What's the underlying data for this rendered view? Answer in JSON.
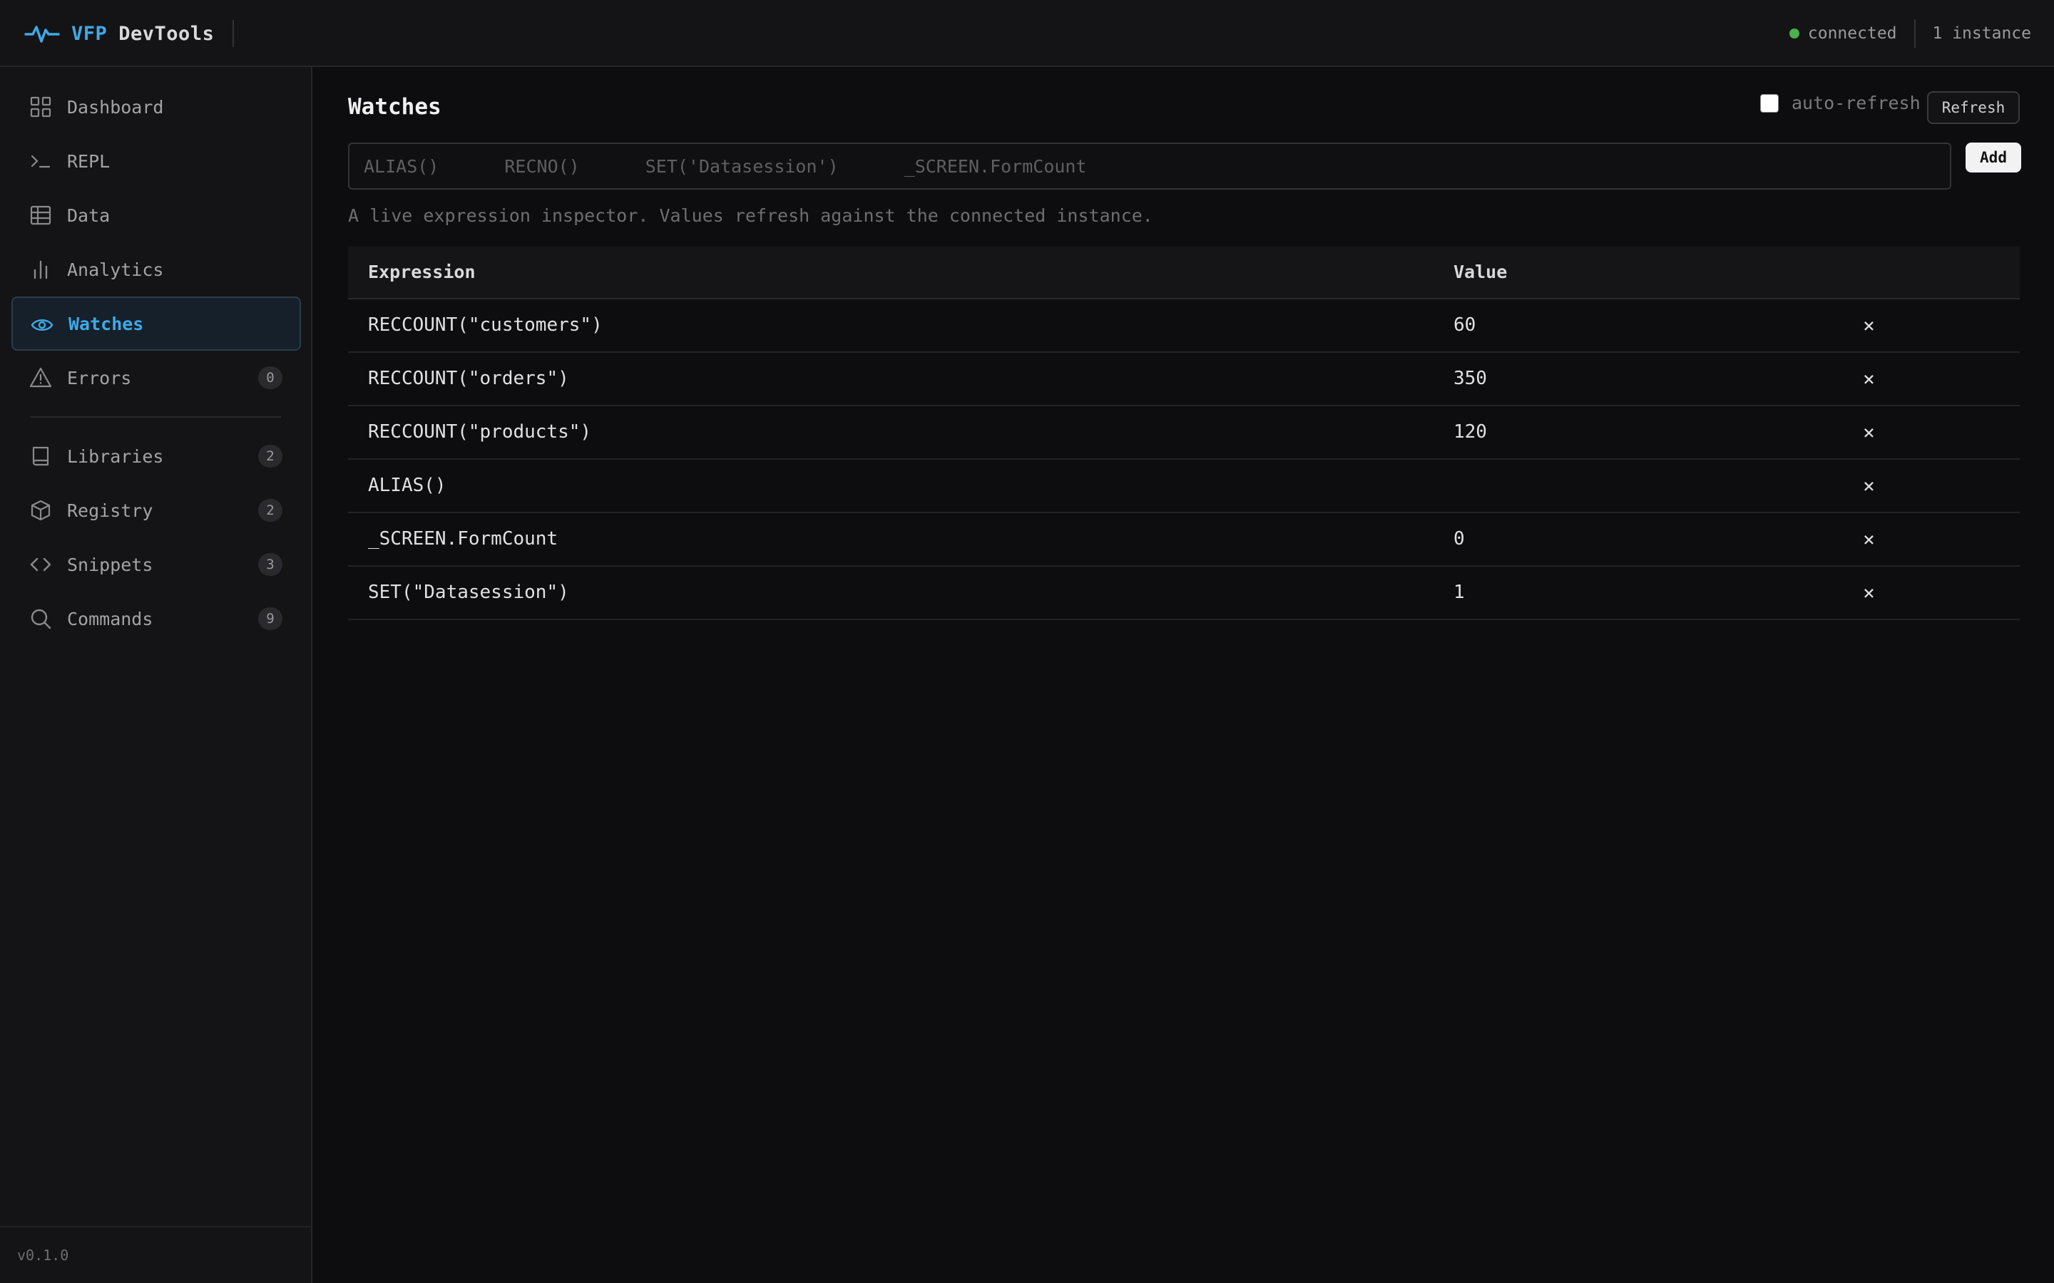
{
  "header": {
    "brand_vfp": "VFP",
    "brand_rest": "DevTools",
    "status": "connected",
    "instances": "1 instance",
    "status_color": "#4caf50",
    "accent_color": "#3fa9e8"
  },
  "sidebar": {
    "items": [
      {
        "label": "Dashboard",
        "icon": "grid-icon"
      },
      {
        "label": "REPL",
        "icon": "terminal-icon"
      },
      {
        "label": "Data",
        "icon": "table-icon"
      },
      {
        "label": "Analytics",
        "icon": "bar-chart-icon"
      },
      {
        "label": "Watches",
        "icon": "eye-icon",
        "active": true
      },
      {
        "label": "Errors",
        "icon": "warning-icon",
        "badge": "0"
      },
      {
        "label": "Libraries",
        "icon": "book-icon",
        "badge": "2"
      },
      {
        "label": "Registry",
        "icon": "cube-icon",
        "badge": "2"
      },
      {
        "label": "Snippets",
        "icon": "code-icon",
        "badge": "3"
      },
      {
        "label": "Commands",
        "icon": "search-icon",
        "badge": "9"
      }
    ],
    "version": "v0.1.0"
  },
  "main": {
    "title": "Watches",
    "auto_refresh_label": "auto-refresh",
    "refresh_label": "Refresh",
    "add_label": "Add",
    "input_placeholders": [
      "ALIAS()",
      "RECNO()",
      "SET('Datasession')",
      "_SCREEN.FormCount"
    ],
    "description": "A live expression inspector. Values refresh against the connected instance.",
    "table": {
      "headers": {
        "expression": "Expression",
        "value": "Value"
      },
      "delete_glyph": "×",
      "rows": [
        {
          "expression": "RECCOUNT(\"customers\")",
          "value": "60"
        },
        {
          "expression": "RECCOUNT(\"orders\")",
          "value": "350"
        },
        {
          "expression": "RECCOUNT(\"products\")",
          "value": "120"
        },
        {
          "expression": "ALIAS()",
          "value": ""
        },
        {
          "expression": "_SCREEN.FormCount",
          "value": "0"
        },
        {
          "expression": "SET(\"Datasession\")",
          "value": "1"
        }
      ]
    }
  }
}
